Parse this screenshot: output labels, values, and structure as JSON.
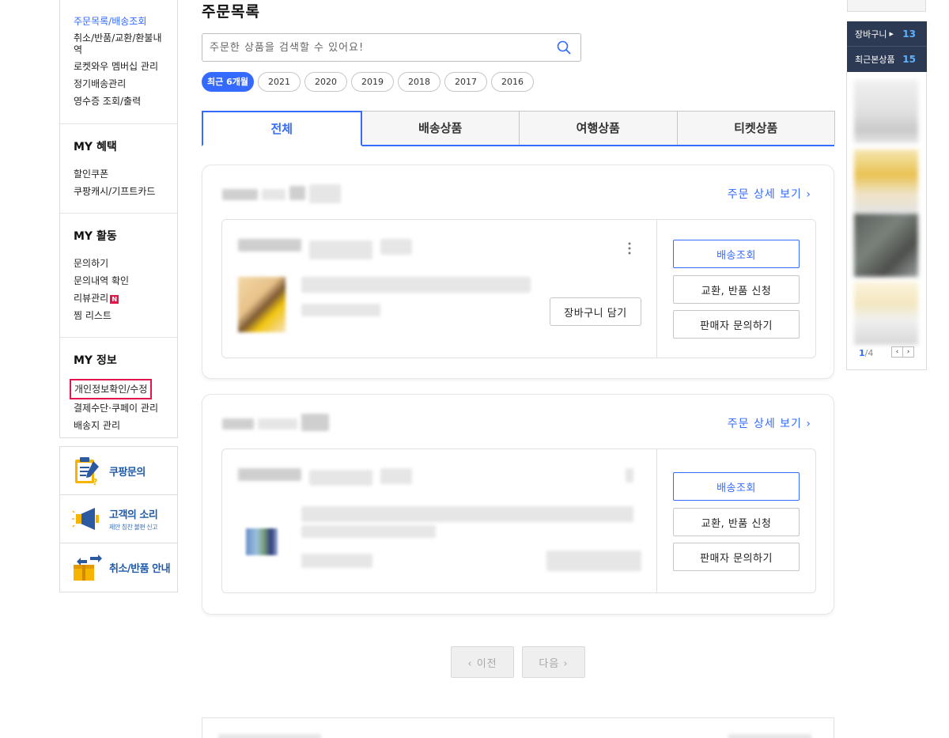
{
  "sidebar": {
    "top_items": [
      "주문목록/배송조회",
      "취소/반품/교환/환불내역",
      "로켓와우 멤버십 관리",
      "정기배송관리",
      "영수증 조회/출력"
    ],
    "benefit_title": "MY 혜택",
    "benefit_items": [
      "할인쿠폰",
      "쿠팡캐시/기프트카드"
    ],
    "activity_title": "MY 활동",
    "activity_items": [
      "문의하기",
      "문의내역 확인",
      "리뷰관리",
      "찜 리스트"
    ],
    "new_badge": "N",
    "info_title": "MY 정보",
    "info_items": [
      "개인정보확인/수정",
      "결제수단·쿠페이 관리",
      "배송지 관리"
    ]
  },
  "banners": {
    "inquiry": "쿠팡문의",
    "voice": "고객의 소리",
    "voice_sub": "제안 칭찬 불편 신고",
    "cancel_guide": "취소/반품 안내"
  },
  "main": {
    "title": "주문목록",
    "search_placeholder": "주문한 상품을 검색할 수 있어요!",
    "years": [
      "최근 6개월",
      "2021",
      "2020",
      "2019",
      "2018",
      "2017",
      "2016"
    ],
    "tabs": [
      "전체",
      "배송상품",
      "여행상품",
      "티켓상품"
    ],
    "order_detail_link": "주문 상세 보기",
    "cart_button": "장바구니 담기",
    "actions": [
      "배송조회",
      "교환, 반품 신청",
      "판매자 문의하기"
    ],
    "prev": "이전",
    "next": "다음"
  },
  "right": {
    "cart_label": "장바구니",
    "cart_count": "13",
    "recent_label": "최근본상품",
    "recent_count": "15",
    "page_current": "1",
    "page_total": "/4"
  },
  "colors": {
    "accent": "#346aff",
    "highlight_box": "#e2144b",
    "right_panel": "#2d3a54"
  }
}
